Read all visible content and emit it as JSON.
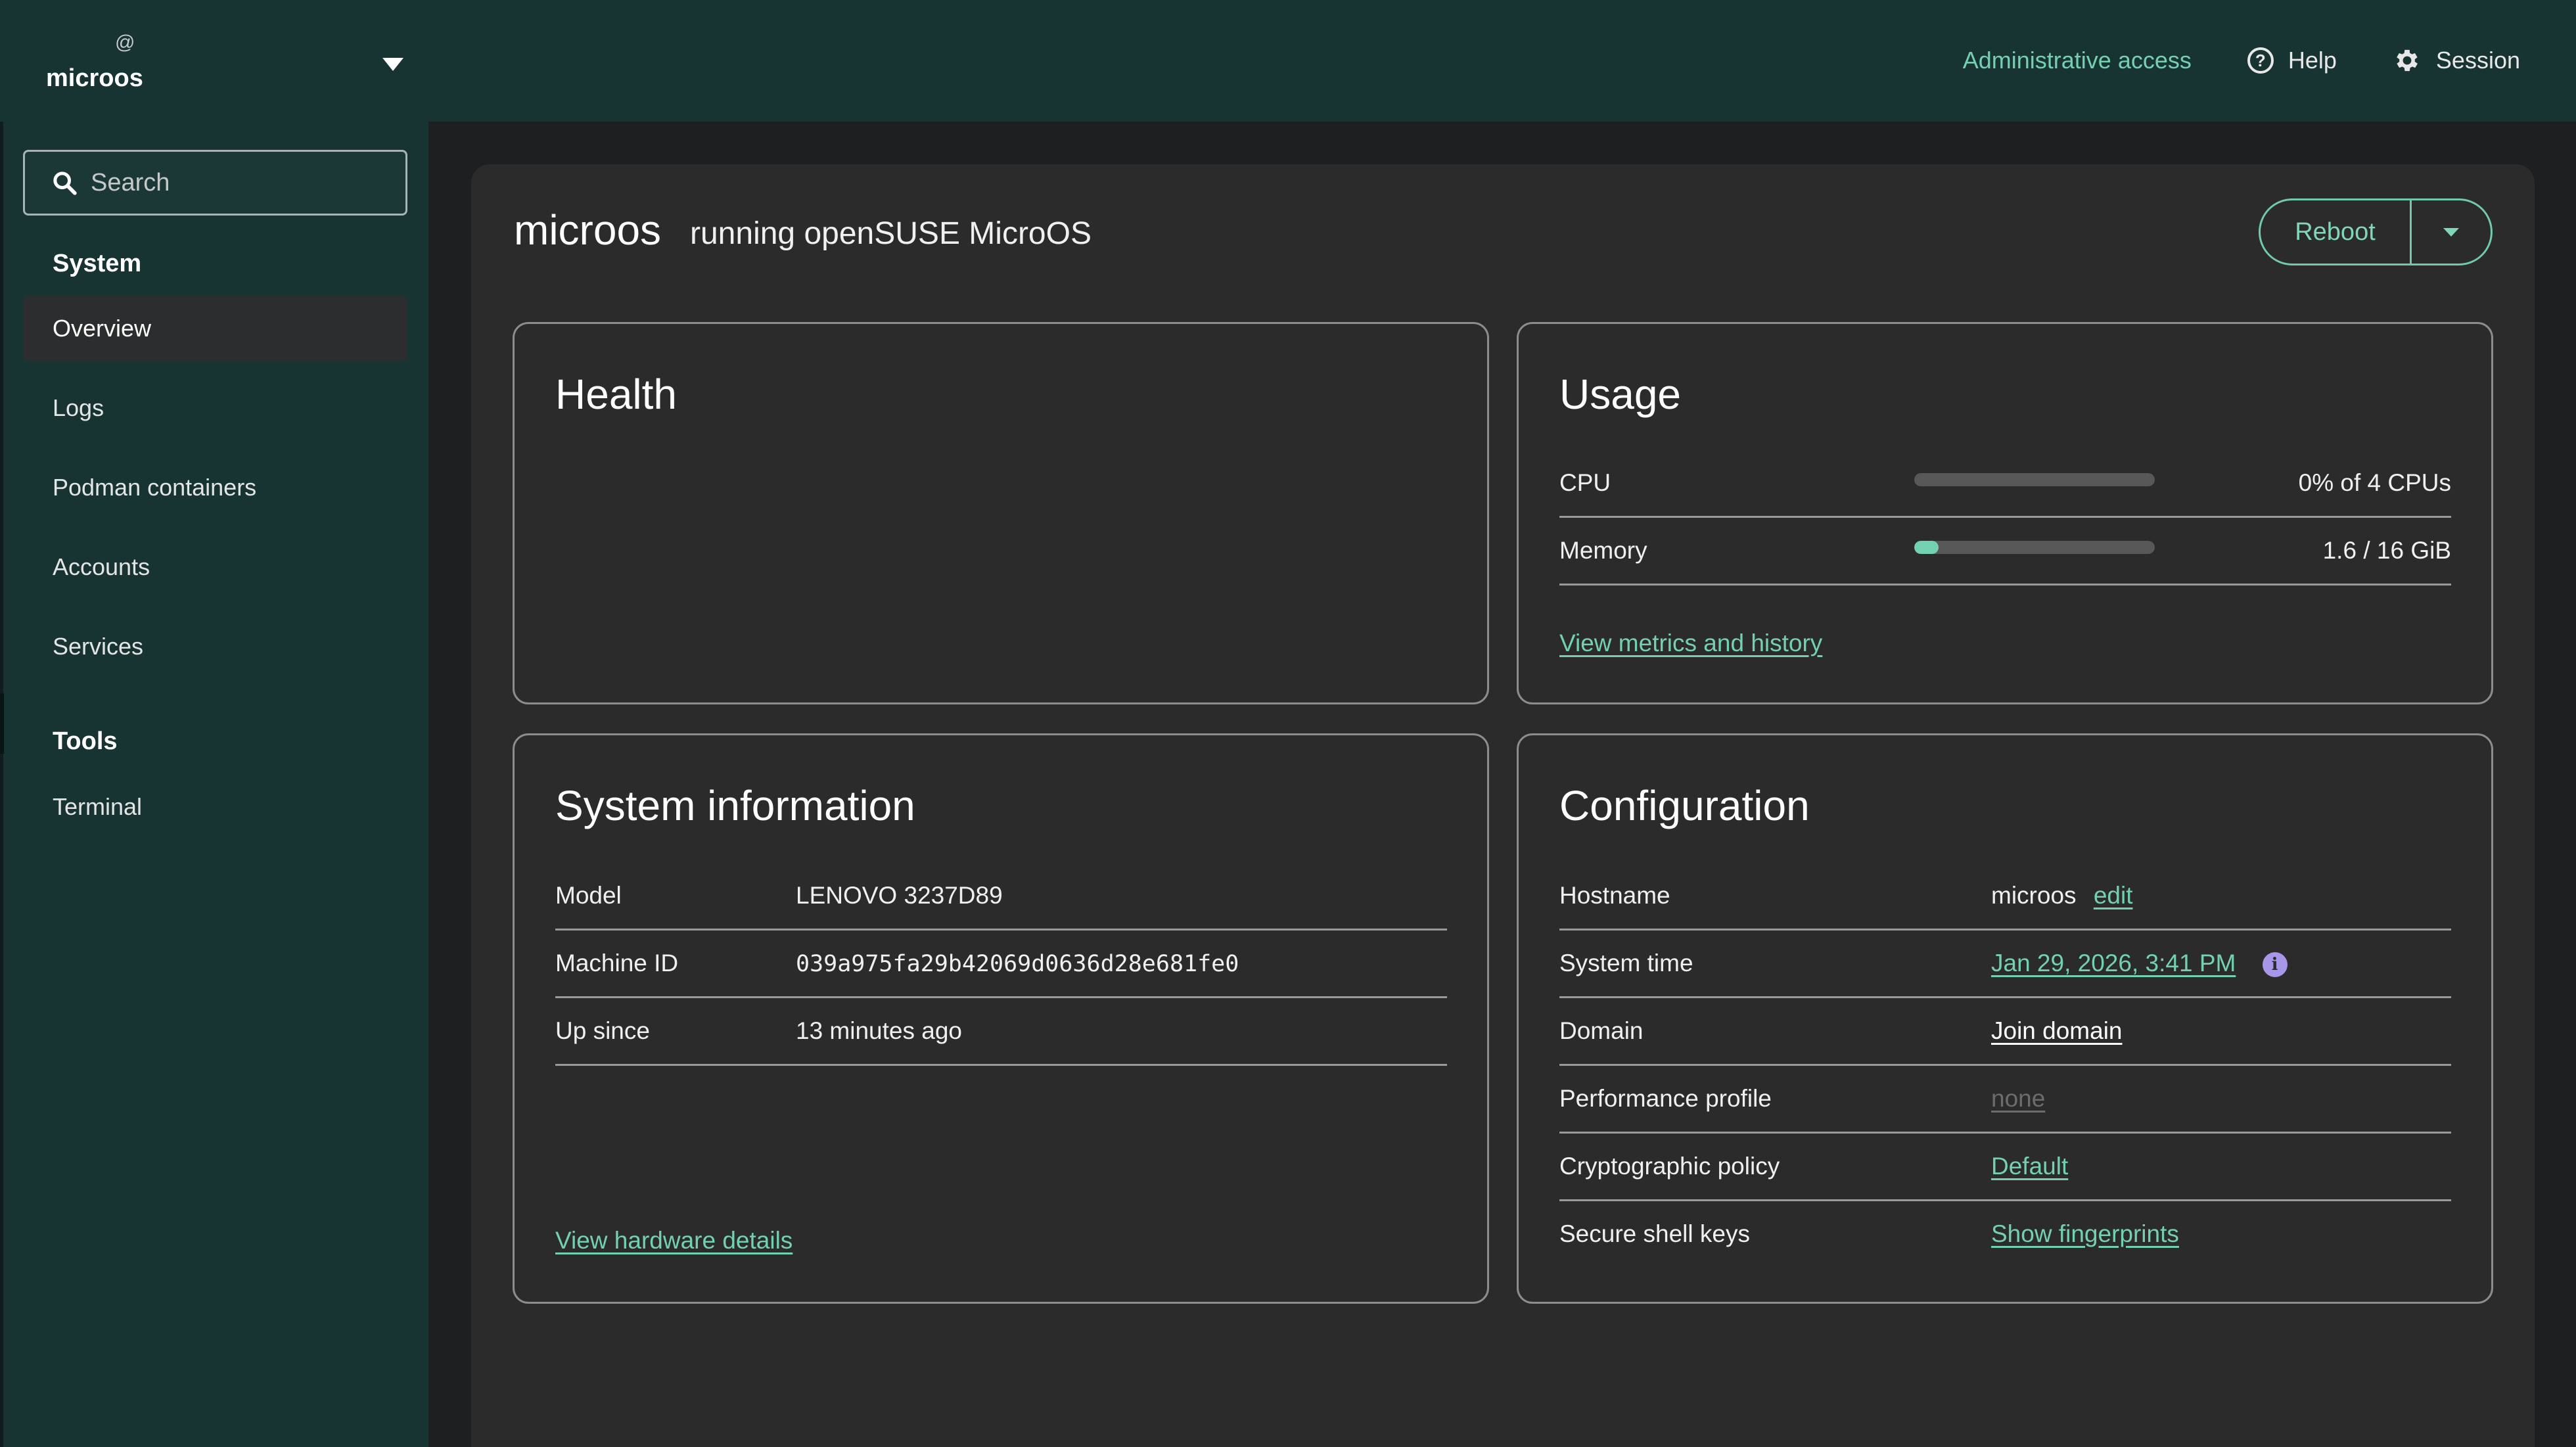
{
  "header": {
    "host_at": "@",
    "host_name": "microos",
    "admin_access": "Administrative access",
    "help": "Help",
    "session": "Session"
  },
  "sidebar": {
    "search_placeholder": "Search",
    "sections": [
      {
        "title": "System",
        "items": [
          "Overview",
          "Logs",
          "Podman containers",
          "Accounts",
          "Services"
        ]
      },
      {
        "title": "Tools",
        "items": [
          "Terminal"
        ]
      }
    ],
    "active_item": "Overview"
  },
  "page": {
    "title": "microos",
    "subtitle": "running openSUSE MicroOS",
    "reboot_label": "Reboot"
  },
  "health": {
    "title": "Health"
  },
  "usage": {
    "title": "Usage",
    "rows": [
      {
        "label": "CPU",
        "value": "0% of 4 CPUs",
        "fraction": 0.0
      },
      {
        "label": "Memory",
        "value": "1.6 / 16 GiB",
        "fraction": 0.1
      }
    ],
    "link": "View metrics and history"
  },
  "system_info": {
    "title": "System information",
    "rows": [
      {
        "label": "Model",
        "value": "LENOVO 3237D89"
      },
      {
        "label": "Machine ID",
        "value": "039a975fa29b42069d0636d28e681fe0"
      },
      {
        "label": "Up since",
        "value": "13 minutes ago"
      }
    ],
    "link": "View hardware details"
  },
  "configuration": {
    "title": "Configuration",
    "hostname_label": "Hostname",
    "hostname_value": "microos",
    "hostname_edit": "edit",
    "system_time_label": "System time",
    "system_time_value": "Jan 29, 2026, 3:41 PM",
    "domain_label": "Domain",
    "domain_value": "Join domain",
    "performance_label": "Performance profile",
    "performance_value": "none",
    "crypto_label": "Cryptographic policy",
    "crypto_value": "Default",
    "ssh_label": "Secure shell keys",
    "ssh_value": "Show fingerprints"
  },
  "colors": {
    "accent": "#73d0b1",
    "header_bg": "#173332",
    "panel_bg": "#2b2b2b",
    "info_icon": "#a897e8"
  },
  "icons": {
    "help": "question-circle-icon",
    "session": "gear-icon",
    "search": "search-icon",
    "time_info": "info-circle-icon"
  }
}
